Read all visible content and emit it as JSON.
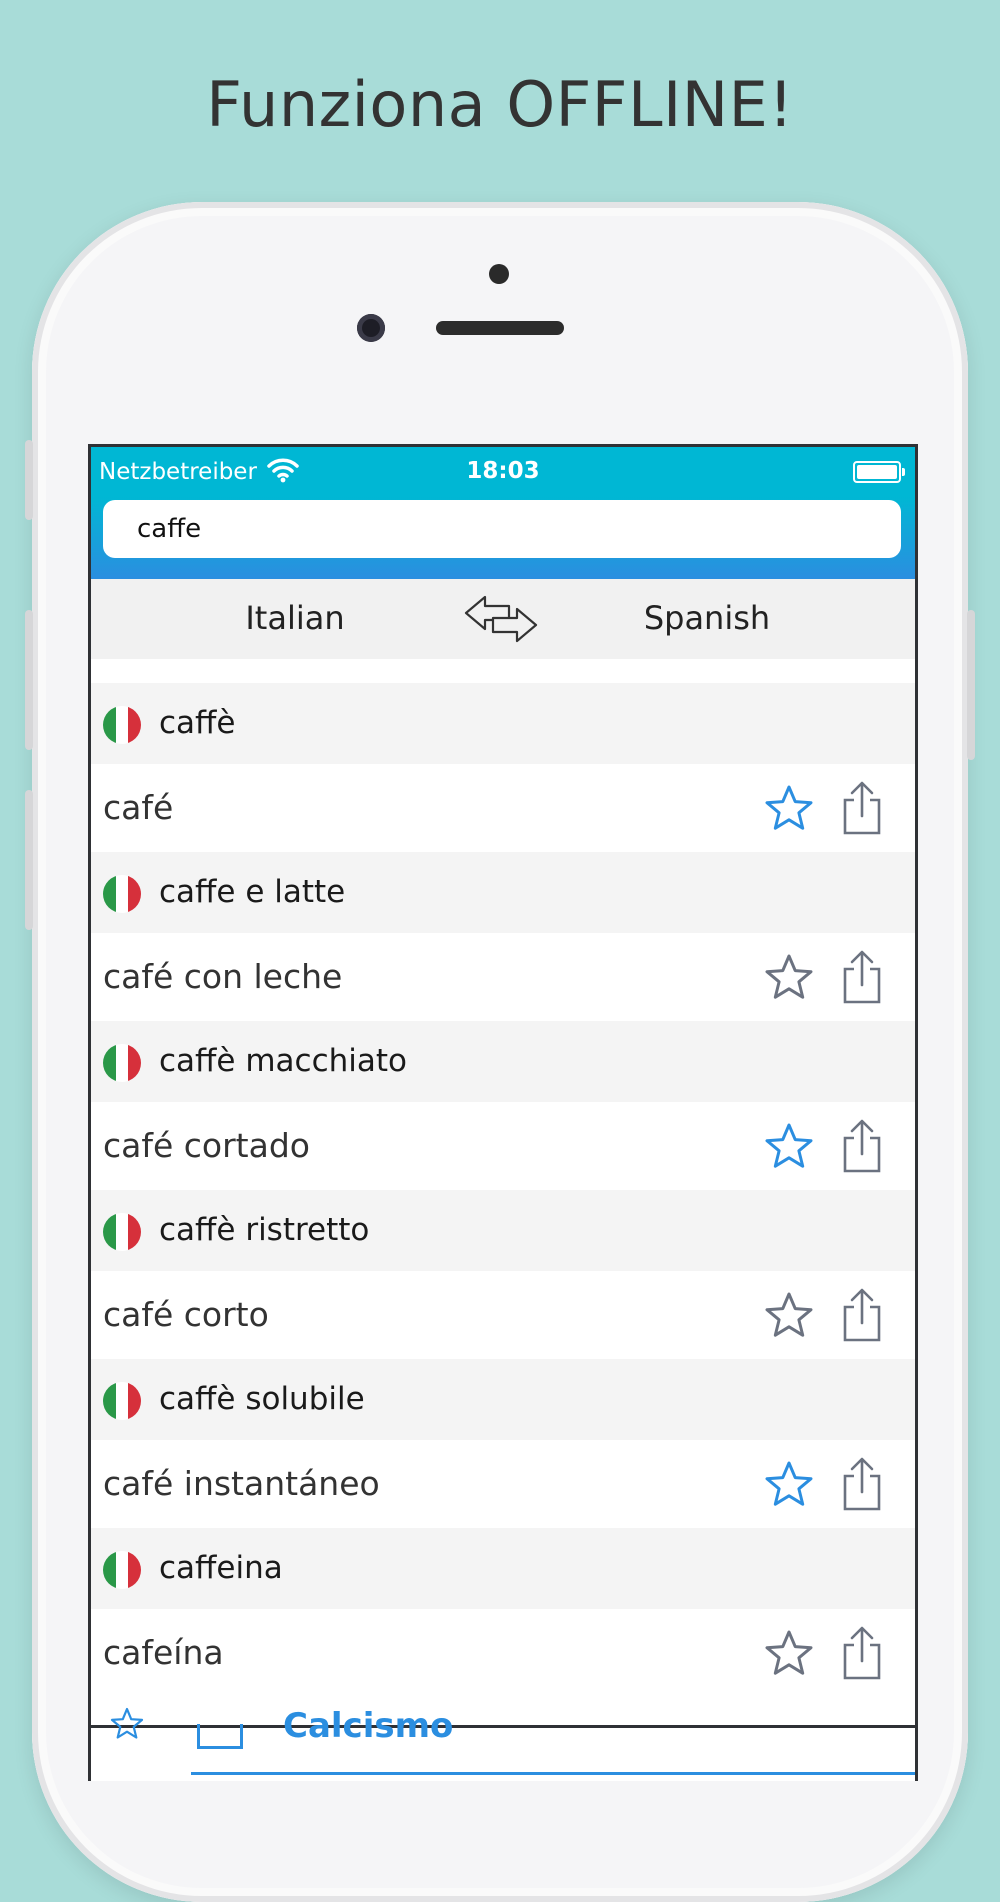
{
  "headline": "Funziona OFFLINE!",
  "status_bar": {
    "carrier": "Netzbetreiber",
    "time": "18:03"
  },
  "search": {
    "value": "caffe",
    "placeholder": ""
  },
  "languages": {
    "source": "Italian",
    "target": "Spanish"
  },
  "entries": [
    {
      "source": "caffè",
      "translation": "café",
      "favorite": true
    },
    {
      "source": "caffe e latte",
      "translation": "café con leche",
      "favorite": false
    },
    {
      "source": "caffè macchiato",
      "translation": "café cortado",
      "favorite": true
    },
    {
      "source": "caffè ristretto",
      "translation": "café corto",
      "favorite": false
    },
    {
      "source": "caffè solubile",
      "translation": "café instantáneo",
      "favorite": true
    },
    {
      "source": "caffeina",
      "translation": "cafeína",
      "favorite": false
    }
  ],
  "tab_bar": {
    "label": "Calcismo"
  },
  "colors": {
    "background": "#a8dcd8",
    "status_bar": "#00b7d4",
    "accent_blue": "#2b8ee0",
    "star_active": "#2b8ee0",
    "star_inactive": "#6b7280"
  },
  "icons": {
    "wifi": "wifi-icon",
    "battery": "battery-icon",
    "swap": "swap-arrows-icon",
    "favorite": "star-icon",
    "share": "share-icon",
    "flag": "italy-flag-icon"
  }
}
